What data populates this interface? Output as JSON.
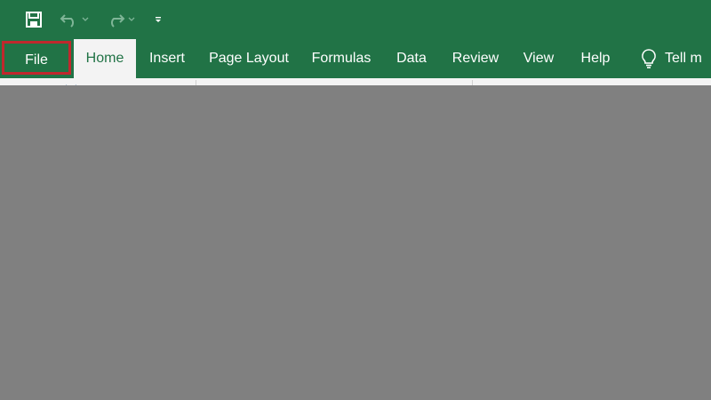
{
  "quick_access": {
    "save_icon": "save-icon",
    "undo_icon": "undo-icon",
    "redo_icon": "redo-icon",
    "customize_icon": "customize-qat-icon"
  },
  "ribbon": {
    "tabs": [
      {
        "label": "File",
        "active": false,
        "highlighted": true
      },
      {
        "label": "Home",
        "active": true
      },
      {
        "label": "Insert"
      },
      {
        "label": "Page Layout"
      },
      {
        "label": "Formulas"
      },
      {
        "label": "Data"
      },
      {
        "label": "Review"
      },
      {
        "label": "View"
      },
      {
        "label": "Help"
      }
    ],
    "tell_me": {
      "icon": "lightbulb-icon",
      "label": "Tell m"
    }
  },
  "clipboard_group": {
    "paste_icon": "paste-icon",
    "cut_icon": "cut-icon"
  },
  "colors": {
    "brand_green": "#217346",
    "highlight_red": "#c0282d",
    "ribbon_bg": "#f3f3f3",
    "overlay_gray": "#808080"
  }
}
